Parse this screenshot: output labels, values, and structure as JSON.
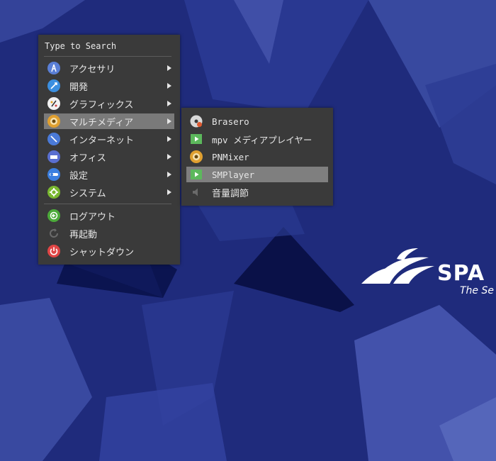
{
  "desktop": {
    "background_color": "#1e2a7a",
    "logo_text": "SPA",
    "logo_tagline": "The Se"
  },
  "menu": {
    "search_placeholder": "Type to Search",
    "items": [
      {
        "label": "アクセサリ",
        "icon": "accessories-icon",
        "submenu": true
      },
      {
        "label": "開発",
        "icon": "development-icon",
        "submenu": true
      },
      {
        "label": "グラフィックス",
        "icon": "graphics-icon",
        "submenu": true
      },
      {
        "label": "マルチメディア",
        "icon": "multimedia-icon",
        "submenu": true,
        "active": true
      },
      {
        "label": "インターネット",
        "icon": "internet-icon",
        "submenu": true
      },
      {
        "label": "オフィス",
        "icon": "office-icon",
        "submenu": true
      },
      {
        "label": "設定",
        "icon": "settings-icon",
        "submenu": true
      },
      {
        "label": "システム",
        "icon": "system-icon",
        "submenu": true
      }
    ],
    "actions": [
      {
        "label": "ログアウト",
        "icon": "logout-icon"
      },
      {
        "label": "再起動",
        "icon": "restart-icon"
      },
      {
        "label": "シャットダウン",
        "icon": "shutdown-icon"
      }
    ]
  },
  "submenu": {
    "items": [
      {
        "label": "Brasero",
        "icon": "brasero-icon"
      },
      {
        "label": "mpv メディアプレイヤー",
        "icon": "mpv-icon"
      },
      {
        "label": "PNMixer",
        "icon": "pnmixer-icon"
      },
      {
        "label": "SMPlayer",
        "icon": "smplayer-icon",
        "active": true
      },
      {
        "label": "音量調節",
        "icon": "volume-icon"
      }
    ]
  }
}
